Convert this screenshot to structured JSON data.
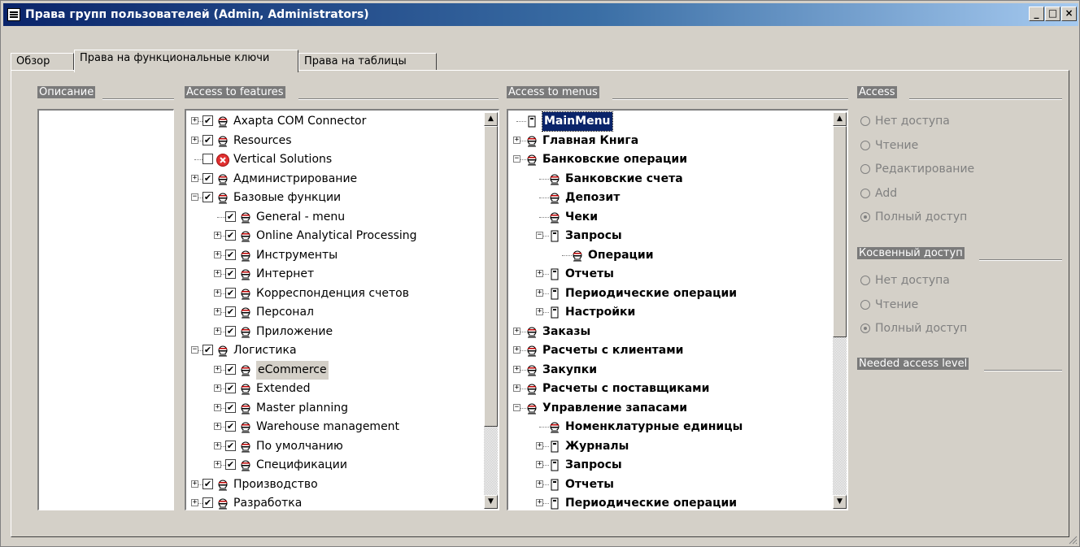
{
  "window": {
    "title": "Права групп пользователей (Admin, Administrators)",
    "buttons": {
      "minimize": "_",
      "maximize": "□",
      "close": "×"
    }
  },
  "tabs": [
    {
      "label": "Обзор",
      "active": false
    },
    {
      "label": "Права на функциональные ключи",
      "active": true
    },
    {
      "label": "Права на таблицы",
      "active": false
    }
  ],
  "groups": {
    "description": "Описание",
    "features": "Access to features",
    "menus": "Access to menus",
    "access": "Access",
    "indirect": "Косвенный доступ",
    "needed": "Needed access level"
  },
  "features_tree": [
    {
      "label": "Axapta COM Connector",
      "level": 0,
      "expander": "+",
      "checked": true,
      "icon": "gear-icon"
    },
    {
      "label": "Resources",
      "level": 0,
      "expander": "+",
      "checked": true,
      "icon": "gear-icon"
    },
    {
      "label": "Vertical Solutions",
      "level": 0,
      "expander": "",
      "checked": false,
      "icon": "error-icon"
    },
    {
      "label": "Администрирование",
      "level": 0,
      "expander": "+",
      "checked": true,
      "icon": "gear-icon"
    },
    {
      "label": "Базовые функции",
      "level": 0,
      "expander": "-",
      "checked": true,
      "icon": "gear-icon"
    },
    {
      "label": "General - menu",
      "level": 1,
      "expander": "",
      "checked": true,
      "icon": "gear-icon"
    },
    {
      "label": "Online Analytical Processing",
      "level": 1,
      "expander": "+",
      "checked": true,
      "icon": "gear-icon"
    },
    {
      "label": "Инструменты",
      "level": 1,
      "expander": "+",
      "checked": true,
      "icon": "gear-icon"
    },
    {
      "label": "Интернет",
      "level": 1,
      "expander": "+",
      "checked": true,
      "icon": "gear-icon"
    },
    {
      "label": "Корреспонденция счетов",
      "level": 1,
      "expander": "+",
      "checked": true,
      "icon": "gear-icon"
    },
    {
      "label": "Персонал",
      "level": 1,
      "expander": "+",
      "checked": true,
      "icon": "gear-icon"
    },
    {
      "label": "Приложение",
      "level": 1,
      "expander": "+",
      "checked": true,
      "icon": "gear-icon"
    },
    {
      "label": "Логистика",
      "level": 0,
      "expander": "-",
      "checked": true,
      "icon": "gear-icon"
    },
    {
      "label": "eCommerce",
      "level": 1,
      "expander": "+",
      "checked": true,
      "icon": "gear-icon",
      "highlight": true
    },
    {
      "label": "Extended",
      "level": 1,
      "expander": "+",
      "checked": true,
      "icon": "gear-icon"
    },
    {
      "label": "Master planning",
      "level": 1,
      "expander": "+",
      "checked": true,
      "icon": "gear-icon"
    },
    {
      "label": "Warehouse management",
      "level": 1,
      "expander": "+",
      "checked": true,
      "icon": "gear-icon"
    },
    {
      "label": "По умолчанию",
      "level": 1,
      "expander": "+",
      "checked": true,
      "icon": "gear-icon"
    },
    {
      "label": "Спецификации",
      "level": 1,
      "expander": "+",
      "checked": true,
      "icon": "gear-icon"
    },
    {
      "label": "Производство",
      "level": 0,
      "expander": "+",
      "checked": true,
      "icon": "gear-icon"
    },
    {
      "label": "Разработка",
      "level": 0,
      "expander": "+",
      "checked": true,
      "icon": "gear-icon"
    }
  ],
  "menus_tree": [
    {
      "label": "MainMenu",
      "level": 0,
      "expander": "",
      "icon": "menu-icon",
      "selected": true
    },
    {
      "label": "Главная Книга",
      "level": 0,
      "expander": "+",
      "icon": "gear-icon"
    },
    {
      "label": "Банковские операции",
      "level": 0,
      "expander": "-",
      "icon": "gear-icon"
    },
    {
      "label": "Банковские счета",
      "level": 1,
      "expander": "",
      "icon": "gear-icon"
    },
    {
      "label": "Депозит",
      "level": 1,
      "expander": "",
      "icon": "gear-icon"
    },
    {
      "label": "Чеки",
      "level": 1,
      "expander": "",
      "icon": "gear-icon"
    },
    {
      "label": "Запросы",
      "level": 1,
      "expander": "-",
      "icon": "menu-icon"
    },
    {
      "label": "Операции",
      "level": 2,
      "expander": "",
      "icon": "gear-icon"
    },
    {
      "label": "Отчеты",
      "level": 1,
      "expander": "+",
      "icon": "menu-icon"
    },
    {
      "label": "Периодические операции",
      "level": 1,
      "expander": "+",
      "icon": "menu-icon"
    },
    {
      "label": "Настройки",
      "level": 1,
      "expander": "+",
      "icon": "menu-icon"
    },
    {
      "label": "Заказы",
      "level": 0,
      "expander": "+",
      "icon": "gear-icon"
    },
    {
      "label": "Расчеты с клиентами",
      "level": 0,
      "expander": "+",
      "icon": "gear-icon"
    },
    {
      "label": "Закупки",
      "level": 0,
      "expander": "+",
      "icon": "gear-icon"
    },
    {
      "label": "Расчеты с поставщиками",
      "level": 0,
      "expander": "+",
      "icon": "gear-icon"
    },
    {
      "label": "Управление запасами",
      "level": 0,
      "expander": "-",
      "icon": "gear-icon"
    },
    {
      "label": "Номенклатурные единицы",
      "level": 1,
      "expander": "",
      "icon": "gear-icon"
    },
    {
      "label": "Журналы",
      "level": 1,
      "expander": "+",
      "icon": "menu-icon"
    },
    {
      "label": "Запросы",
      "level": 1,
      "expander": "+",
      "icon": "menu-icon"
    },
    {
      "label": "Отчеты",
      "level": 1,
      "expander": "+",
      "icon": "menu-icon"
    },
    {
      "label": "Периодические операции",
      "level": 1,
      "expander": "+",
      "icon": "menu-icon"
    }
  ],
  "access_options": [
    {
      "label": "Нет доступа",
      "selected": false
    },
    {
      "label": "Чтение",
      "selected": false
    },
    {
      "label": "Редактирование",
      "selected": false
    },
    {
      "label": "Add",
      "selected": false
    },
    {
      "label": "Полный доступ",
      "selected": true
    }
  ],
  "indirect_options": [
    {
      "label": "Нет доступа",
      "selected": false
    },
    {
      "label": "Чтение",
      "selected": false
    },
    {
      "label": "Полный доступ",
      "selected": true
    }
  ]
}
